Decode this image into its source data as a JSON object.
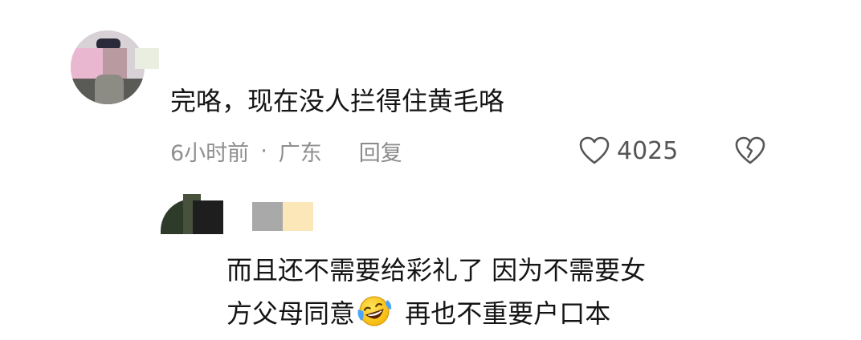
{
  "main_comment": {
    "text": "完咯，现在没人拦得住黄毛咯",
    "time": "6小时前",
    "separator": "·",
    "location": "广东",
    "reply_label": "回复",
    "like_count": "4025"
  },
  "reply_comment": {
    "text_line1": "而且还不需要给彩礼了 因为不需要女",
    "text_line2_before_emoji": "方父母同意",
    "emoji": "laughing-crying-face",
    "text_line2_after_emoji": " 再也不重要户口本"
  },
  "colors": {
    "text_primary": "#151515",
    "text_meta": "#8f8f8f",
    "icon_stroke": "#555555"
  }
}
